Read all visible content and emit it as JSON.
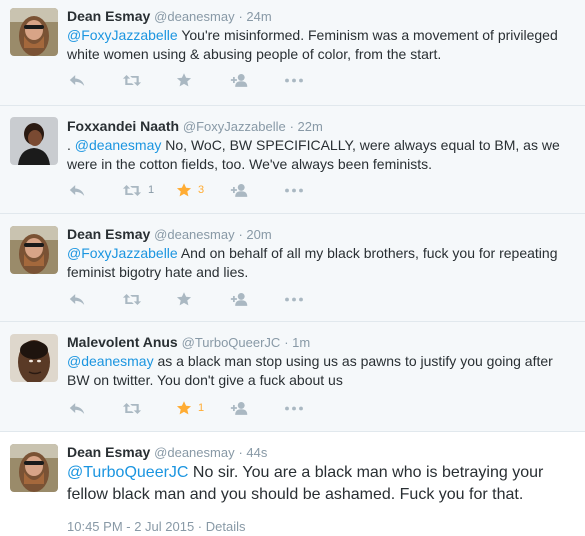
{
  "tweets": [
    {
      "name": "Dean Esmay",
      "handle": "@deanesmay",
      "time": "· 24m",
      "mention": "@FoxyJazzabelle",
      "text": " You're misinformed. Feminism was a movement of privileged white women using & abusing people of color, from the start.",
      "retweets": "",
      "favorites": "",
      "favorited": false
    },
    {
      "name": "Foxxandei Naath",
      "handle": "@FoxyJazzabelle",
      "time": "· 22m",
      "prefix": ". ",
      "mention": "@deanesmay",
      "text": " No, WoC, BW SPECIFICALLY, were always equal to BM, as we were in the cotton fields, too. We've always been feminists.",
      "retweets": "1",
      "favorites": "3",
      "favorited": true
    },
    {
      "name": "Dean Esmay",
      "handle": "@deanesmay",
      "time": "· 20m",
      "mention": "@FoxyJazzabelle",
      "text": " And on behalf of all my black brothers, fuck you for repeating feminist bigotry hate and lies.",
      "retweets": "",
      "favorites": "",
      "favorited": false
    },
    {
      "name": "Malevolent Anus",
      "handle": "@TurboQueerJC",
      "time": "· 1m",
      "mention": "@deanesmay",
      "text": " as a black man stop using us as pawns to justify you going after BW on twitter. You don't give a fuck about us",
      "retweets": "",
      "favorites": "1",
      "favorited": true
    },
    {
      "name": "Dean Esmay",
      "handle": "@deanesmay",
      "time": "· 44s",
      "mention": "@TurboQueerJC",
      "text": " No sir. You are a black man who is betraying your fellow black man and you should be ashamed. Fuck you for that.",
      "footer": "10:45 PM - 2 Jul 2015 · Details"
    }
  ],
  "colors": {
    "link": "#1b95e0",
    "icon": "#aab8c2",
    "gold": "#ffac33",
    "bg_conversation": "#f5f8fa"
  },
  "icons": [
    "reply-icon",
    "retweet-icon",
    "favorite-icon",
    "follow-icon",
    "more-icon"
  ]
}
